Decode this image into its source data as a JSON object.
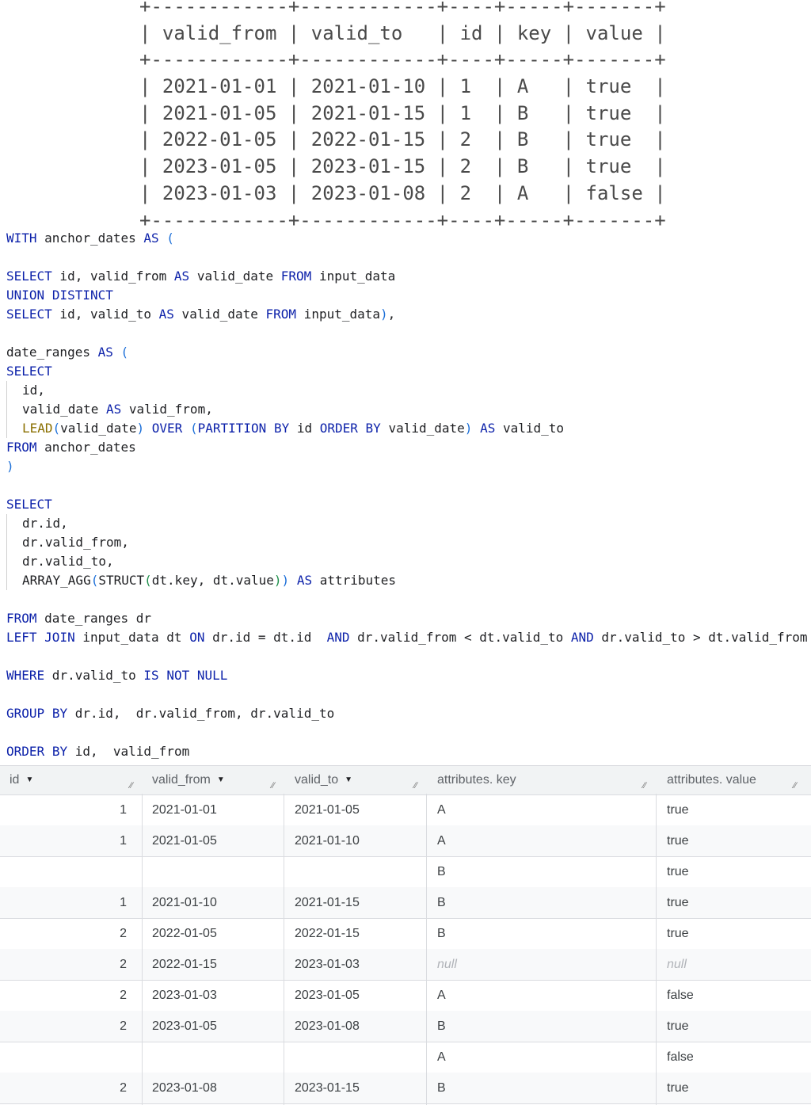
{
  "ascii_table": {
    "lines": [
      "+------------+------------+----+-----+-------+",
      "| valid_from | valid_to   | id | key | value |",
      "+------------+------------+----+-----+-------+",
      "| 2021-01-01 | 2021-01-10 | 1  | A   | true  |",
      "| 2021-01-05 | 2021-01-15 | 1  | B   | true  |",
      "| 2022-01-05 | 2022-01-15 | 2  | B   | true  |",
      "| 2023-01-05 | 2023-01-15 | 2  | B   | true  |",
      "| 2023-01-03 | 2023-01-08 | 2  | A   | false |",
      "+------------+------------+----+-----+-------+"
    ]
  },
  "sql": {
    "lines": [
      "WITH anchor_dates AS (",
      "",
      "SELECT id, valid_from AS valid_date FROM input_data",
      "UNION DISTINCT",
      "SELECT id, valid_to AS valid_date FROM input_data),",
      "",
      "date_ranges AS (",
      "SELECT",
      "id,",
      "valid_date AS valid_from,",
      "LEAD(valid_date) OVER (PARTITION BY id ORDER BY valid_date) AS valid_to",
      "FROM anchor_dates",
      ")",
      "",
      "SELECT",
      "dr.id,",
      "dr.valid_from,",
      "dr.valid_to,",
      "ARRAY_AGG(STRUCT(dt.key, dt.value)) AS attributes",
      "",
      "FROM date_ranges dr",
      "LEFT JOIN input_data dt ON dr.id = dt.id  AND dr.valid_from < dt.valid_to AND dr.valid_to > dt.valid_from",
      "",
      "WHERE dr.valid_to IS NOT NULL",
      "",
      "GROUP BY dr.id,  dr.valid_from, dr.valid_to",
      "",
      "ORDER BY id,  valid_from"
    ]
  },
  "results": {
    "columns": [
      {
        "label": "id",
        "sortable": true
      },
      {
        "label": "valid_from",
        "sortable": true
      },
      {
        "label": "valid_to",
        "sortable": true
      },
      {
        "label": "attributes. key",
        "sortable": false
      },
      {
        "label": "attributes. value",
        "sortable": false
      }
    ],
    "rows": [
      {
        "id": "1",
        "valid_from": "2021-01-01",
        "valid_to": "2021-01-05",
        "key": "A",
        "value": "true"
      },
      {
        "id": "1",
        "valid_from": "2021-01-05",
        "valid_to": "2021-01-10",
        "key": "A",
        "value": "true"
      },
      {
        "id": "",
        "valid_from": "",
        "valid_to": "",
        "key": "B",
        "value": "true"
      },
      {
        "id": "1",
        "valid_from": "2021-01-10",
        "valid_to": "2021-01-15",
        "key": "B",
        "value": "true"
      },
      {
        "id": "2",
        "valid_from": "2022-01-05",
        "valid_to": "2022-01-15",
        "key": "B",
        "value": "true"
      },
      {
        "id": "2",
        "valid_from": "2022-01-15",
        "valid_to": "2023-01-03",
        "key": "null",
        "value": "null"
      },
      {
        "id": "2",
        "valid_from": "2023-01-03",
        "valid_to": "2023-01-05",
        "key": "A",
        "value": "false"
      },
      {
        "id": "2",
        "valid_from": "2023-01-05",
        "valid_to": "2023-01-08",
        "key": "B",
        "value": "true"
      },
      {
        "id": "",
        "valid_from": "",
        "valid_to": "",
        "key": "A",
        "value": "false"
      },
      {
        "id": "2",
        "valid_from": "2023-01-08",
        "valid_to": "2023-01-15",
        "key": "B",
        "value": "true"
      }
    ]
  },
  "icons": {
    "sort": "caret-down-icon",
    "resize": "column-resize-icon"
  }
}
